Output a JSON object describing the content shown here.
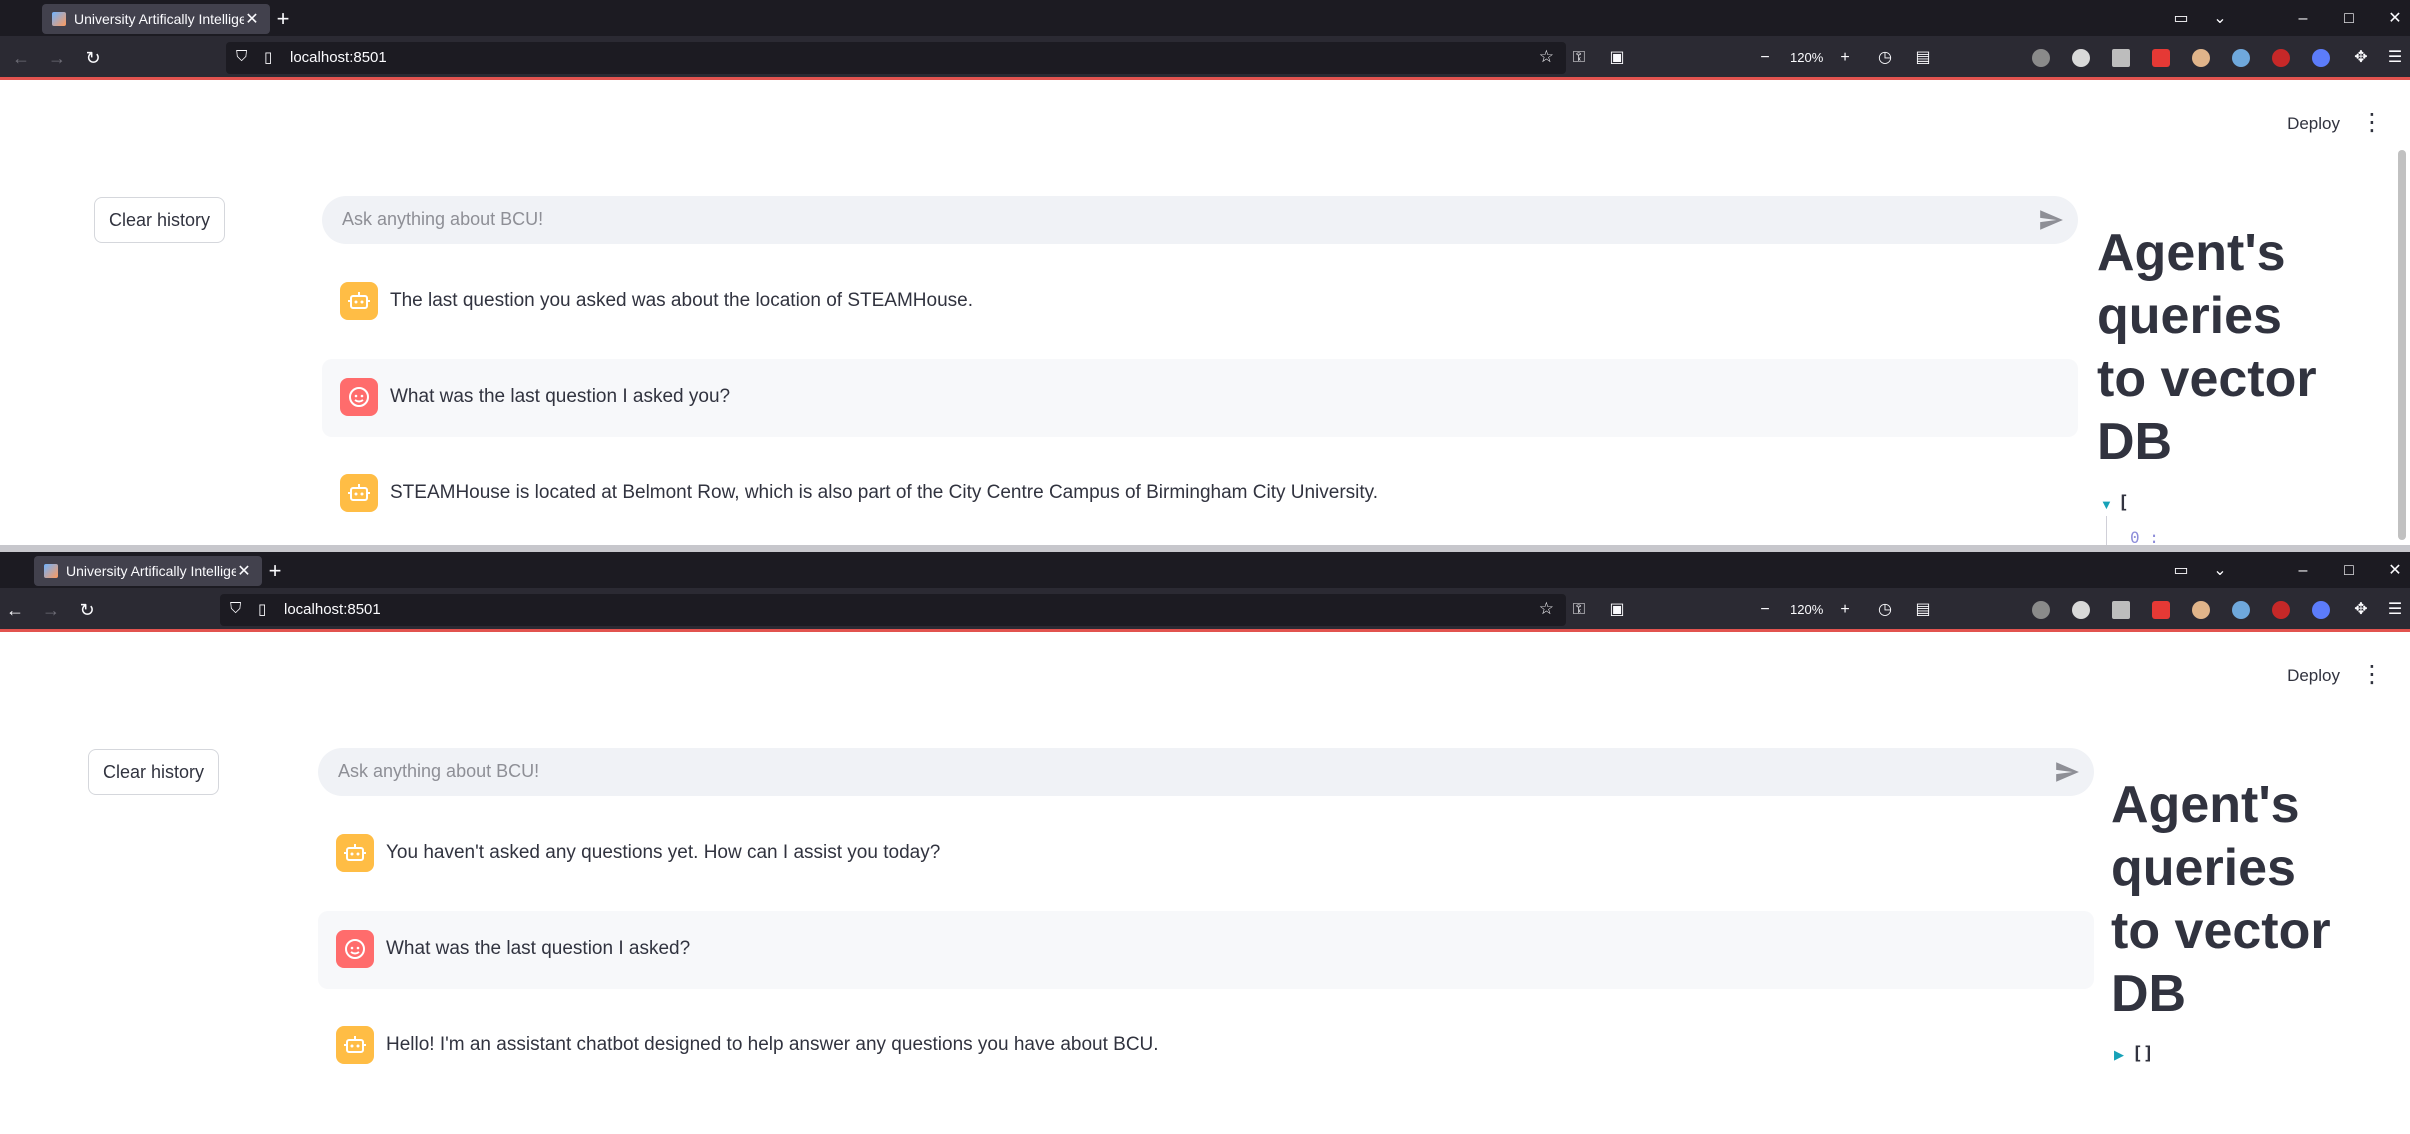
{
  "browser": {
    "tab_title": "University Artifically Intelligent",
    "url": "localhost:8501",
    "zoom": "120%"
  },
  "app": {
    "deploy_label": "Deploy",
    "clear_history_label": "Clear history",
    "chat_placeholder": "Ask anything about BCU!",
    "sidebar_title_lines": [
      "Agent's",
      "queries",
      "to vector",
      "DB"
    ]
  },
  "windows": [
    {
      "messages": [
        {
          "role": "assistant",
          "text": "The last question you asked was about the location of STEAMHouse."
        },
        {
          "role": "user",
          "text": "What was the last question I asked you?"
        },
        {
          "role": "assistant",
          "text": "STEAMHouse is located at Belmont Row, which is also part of the City Centre Campus of Birmingham City University."
        }
      ],
      "json_view": {
        "open_bracket": "[",
        "first_index": "0 :"
      }
    },
    {
      "messages": [
        {
          "role": "assistant",
          "text": "You haven't asked any questions yet. How can I assist you today?"
        },
        {
          "role": "user",
          "text": "What was the last question I asked?"
        },
        {
          "role": "assistant",
          "text": "Hello! I'm an assistant chatbot designed to help answer any questions you have about BCU."
        }
      ],
      "json_view": {
        "empty": "[]"
      }
    }
  ],
  "colors": {
    "bot_avatar": "#ffbd45",
    "user_avatar": "#ff6c6c",
    "accent_line": "#e2534f"
  }
}
